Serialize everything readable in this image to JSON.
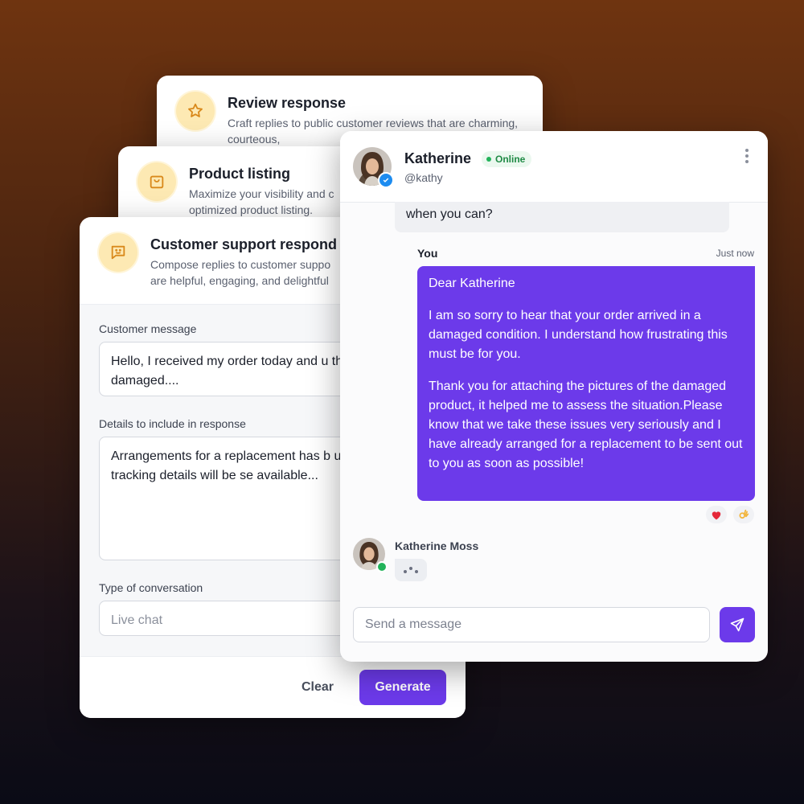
{
  "templates": {
    "review": {
      "title": "Review response",
      "description": "Craft replies to public customer reviews that are charming, courteous,",
      "icon": "star-icon"
    },
    "product": {
      "title": "Product listing",
      "description": "Maximize your visibility and c optimized product listing.",
      "icon": "shopping-bag-icon"
    },
    "support": {
      "title": "Customer support respond",
      "description": "Compose replies to customer suppo are helpful, engaging, and delightful",
      "icon": "chat-smile-icon",
      "fields": {
        "customer_message_label": "Customer message",
        "customer_message_value": "Hello, I received my order today and u the item is damaged....",
        "details_label": "Details to include in response",
        "details_value": "Arrangements for a replacement has b update with tracking details will be se available...",
        "conversation_type_label": "Type of conversation",
        "conversation_type_placeholder": "Live chat"
      },
      "clear_label": "Clear",
      "generate_label": "Generate"
    }
  },
  "chat": {
    "contact_name": "Katherine",
    "status": "Online",
    "handle": "@kathy",
    "previous_message_tail": "when you can?",
    "sender_label": "You",
    "timestamp": "Just now",
    "message_paragraphs": [
      "Dear Katherine",
      "I am so sorry to hear that your order arrived in a damaged condition. I understand how frustrating this must be for you.",
      "Thank you for attaching the pictures of the damaged product, it helped me to assess the situation.Please know that we take these issues very seriously and I have already arranged for a replacement to be sent out to you as soon as possible!"
    ],
    "reactions": [
      "heart",
      "ok-hand"
    ],
    "typing_user": "Katherine Moss",
    "input_placeholder": "Send a message"
  },
  "colors": {
    "accent": "#6c3aea",
    "online": "#22b35a",
    "icon_bg": "#fde9b3",
    "icon_stroke": "#d9891b"
  }
}
